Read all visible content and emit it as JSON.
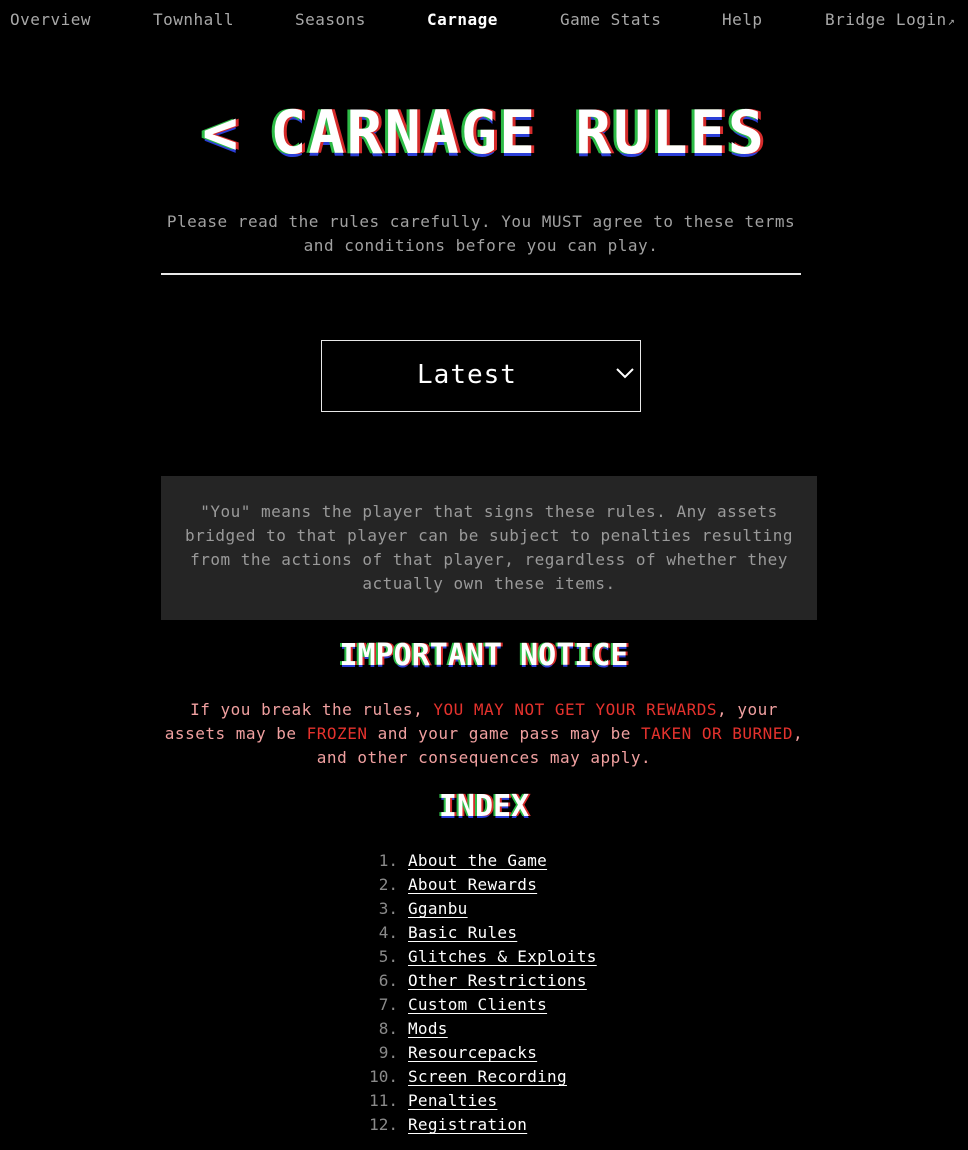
{
  "nav": {
    "items": [
      {
        "label": "Overview"
      },
      {
        "label": "Townhall"
      },
      {
        "label": "Seasons"
      },
      {
        "label": "Carnage"
      },
      {
        "label": "Game Stats"
      },
      {
        "label": "Help"
      },
      {
        "label": "Bridge Login"
      }
    ],
    "active": "Carnage",
    "external_icon": "↗"
  },
  "page": {
    "back_symbol": "<",
    "title": "CARNAGE RULES",
    "intro": "Please read the rules carefully. You MUST agree to these terms and conditions before you can play."
  },
  "version_select": {
    "selected": "Latest",
    "icon": "chevron-down-icon"
  },
  "definition": {
    "text": "\"You\" means the player that signs these rules. Any assets bridged to that player can be subject to penalties resulting from the actions of that player, regardless of whether they actually own these items."
  },
  "notice": {
    "heading": "IMPORTANT NOTICE",
    "part1": "If you break the rules, ",
    "highlight1": "YOU MAY NOT GET YOUR REWARDS",
    "part2": ", your assets may be ",
    "highlight2": "FROZEN",
    "part3": " and your game pass may be ",
    "highlight3": "TAKEN OR BURNED",
    "part4": ", and other consequences may apply."
  },
  "index": {
    "heading": "INDEX",
    "items": [
      {
        "num": "1.",
        "label": "About the Game"
      },
      {
        "num": "2.",
        "label": "About Rewards"
      },
      {
        "num": "3.",
        "label": "Gganbu"
      },
      {
        "num": "4.",
        "label": "Basic Rules"
      },
      {
        "num": "5.",
        "label": "Glitches & Exploits"
      },
      {
        "num": "6.",
        "label": "Other Restrictions"
      },
      {
        "num": "7.",
        "label": "Custom Clients"
      },
      {
        "num": "8.",
        "label": "Mods"
      },
      {
        "num": "9.",
        "label": "Resourcepacks"
      },
      {
        "num": "10.",
        "label": "Screen Recording"
      },
      {
        "num": "11.",
        "label": "Penalties"
      },
      {
        "num": "12.",
        "label": "Registration"
      }
    ]
  },
  "colors": {
    "background": "#000000",
    "accent_red": "#e5322d",
    "notice_text": "#f0a0a0",
    "definition_bg": "#252525"
  }
}
